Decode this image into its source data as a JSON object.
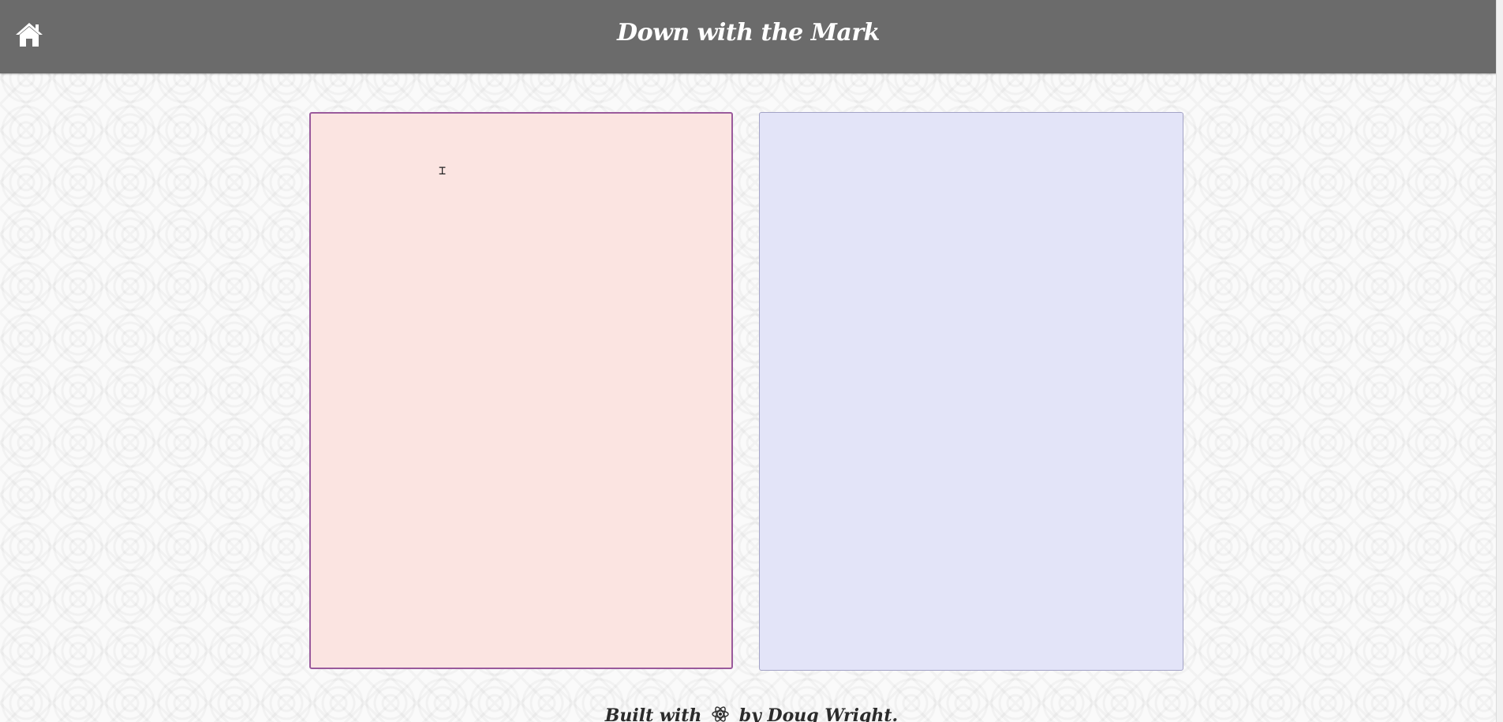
{
  "header": {
    "title": "Down with the Mark",
    "home_icon": "home-icon"
  },
  "editor": {
    "value": "",
    "placeholder": ""
  },
  "preview": {
    "content": ""
  },
  "footer": {
    "prefix": "Built with",
    "icon": "react-icon",
    "suffix": "by Doug Wright."
  },
  "colors": {
    "header_bg": "#6b6b6b",
    "editor_bg": "#fbe4e1",
    "editor_border": "#9a5a9c",
    "preview_bg": "#e3e4f8"
  }
}
